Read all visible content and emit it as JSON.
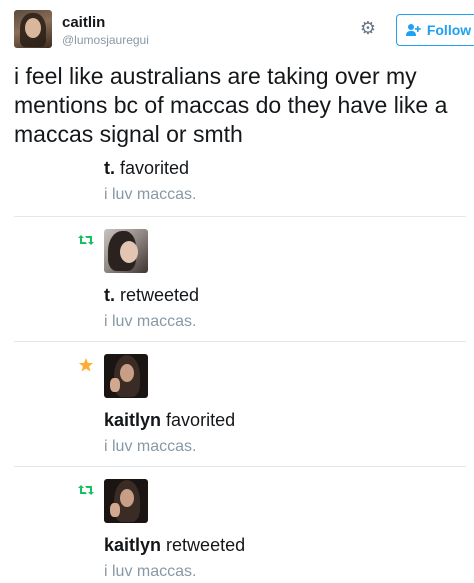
{
  "tweet": {
    "author_name": "caitlin",
    "author_handle": "@lumosjauregui",
    "follow_label": "Follow",
    "text": "i feel like australians are taking over my mentions bc of maccas do they have like a maccas signal or smth"
  },
  "notifications": [
    {
      "type": "favorite",
      "user": "t.",
      "verb": "favorited",
      "preview": "i luv maccas.",
      "show_avatar": false,
      "avatar": "t-avatar"
    },
    {
      "type": "retweet",
      "user": "t.",
      "verb": "retweeted",
      "preview": "i luv maccas.",
      "show_avatar": true,
      "avatar": "t-avatar"
    },
    {
      "type": "favorite",
      "user": "kaitlyn",
      "verb": "favorited",
      "preview": "i luv maccas.",
      "show_avatar": true,
      "avatar": "kaitlyn-avatar"
    },
    {
      "type": "retweet",
      "user": "kaitlyn",
      "verb": "retweeted",
      "preview": "i luv maccas.",
      "show_avatar": true,
      "avatar": "kaitlyn-avatar"
    }
  ],
  "icons": {
    "settings": "gear-icon",
    "follow": "add-user-icon",
    "retweet": "retweet-icon",
    "favorite": "star-icon"
  },
  "colors": {
    "accent": "#1da1f2",
    "retweet": "#17bf63",
    "favorite": "#ffac33",
    "muted": "#8899a6"
  }
}
